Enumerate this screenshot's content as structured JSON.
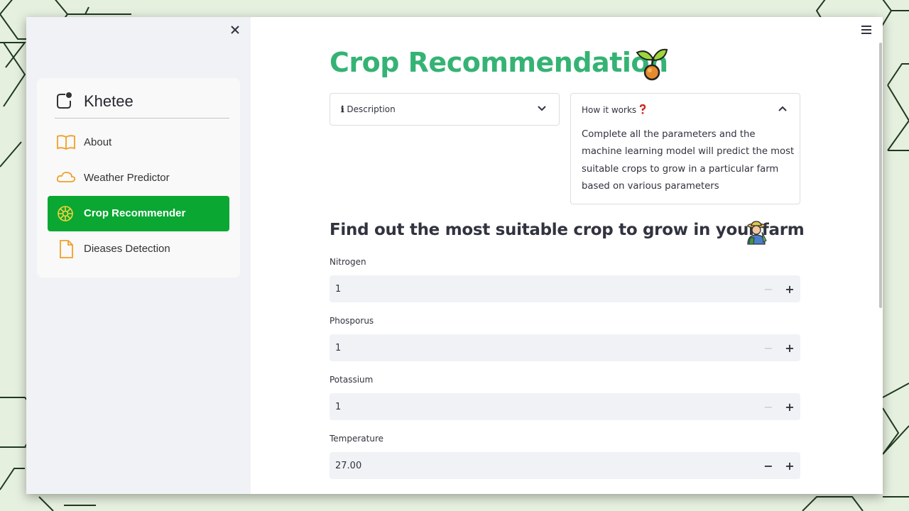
{
  "sidebar": {
    "brand": "Khetee",
    "items": [
      {
        "label": "About",
        "icon": "book-icon",
        "active": false
      },
      {
        "label": "Weather Predictor",
        "icon": "cloud-icon",
        "active": false
      },
      {
        "label": "Crop Recommender",
        "icon": "flower-icon",
        "active": true
      },
      {
        "label": "Dieases Detection",
        "icon": "file-icon",
        "active": false
      }
    ],
    "accent": "#0aa832",
    "icon_color": "#f0a028"
  },
  "main": {
    "title": "Crop Recommendation",
    "title_color": "#35b374",
    "description_expander": {
      "label": "Description",
      "prefix_icon": "info-icon",
      "expanded": false
    },
    "how_it_works_expander": {
      "label": "How it works",
      "suffix_icon": "question-mark-icon",
      "expanded": true,
      "body": "Complete all the parameters and the machine learning model will predict the most suitable crops to grow in a particular farm based on various parameters"
    },
    "subtitle": "Find out the most suitable crop to grow in your farm",
    "fields": [
      {
        "label": "Nitrogen",
        "value": "1",
        "minus_enabled": false
      },
      {
        "label": "Phosporus",
        "value": "1",
        "minus_enabled": false
      },
      {
        "label": "Potassium",
        "value": "1",
        "minus_enabled": false
      },
      {
        "label": "Temperature",
        "value": "27.00",
        "minus_enabled": true
      }
    ]
  }
}
